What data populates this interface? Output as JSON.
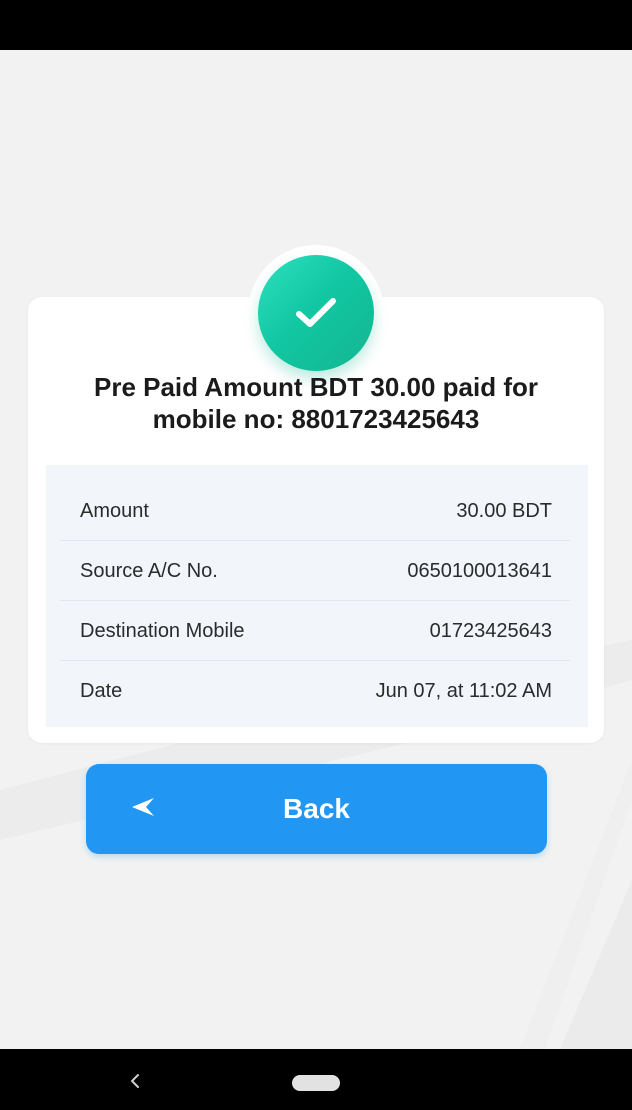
{
  "status_bar": {},
  "receipt": {
    "title_line1": "Pre Paid Amount BDT 30.00 paid for",
    "title_line2": "mobile no: 8801723425643",
    "rows": [
      {
        "label": "Amount",
        "value": "30.00 BDT"
      },
      {
        "label": "Source A/C No.",
        "value": "0650100013641"
      },
      {
        "label": "Destination Mobile",
        "value": "01723425643"
      },
      {
        "label": "Date",
        "value": "Jun 07, at 11:02 AM"
      }
    ]
  },
  "back_button": {
    "label": "Back"
  },
  "icons": {
    "success": "check-icon",
    "back_arrow": "arrow-back-icon",
    "nav_back": "chevron-left-icon",
    "nav_home": "home-pill-icon"
  },
  "colors": {
    "success_green": "#13b690",
    "button_blue": "#2196f3",
    "background": "#f1f2f1",
    "details_background": "#f2f6fb"
  }
}
